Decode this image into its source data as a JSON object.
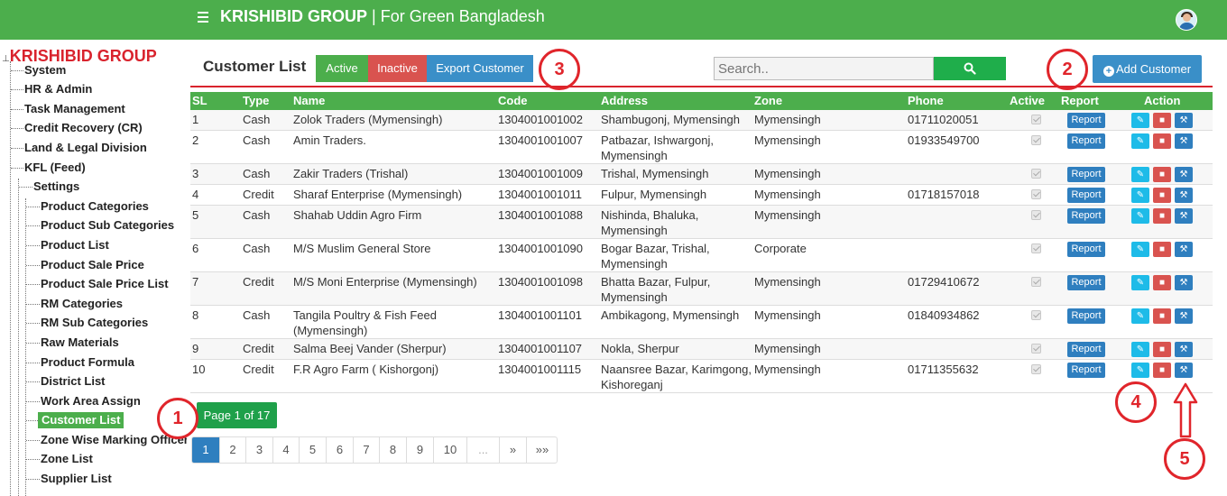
{
  "header": {
    "brand": "KRISHIBID GROUP",
    "separator": " | ",
    "tagline": "For Green Bangladesh"
  },
  "sidebar": {
    "root": "KRISHIBID GROUP",
    "items": [
      {
        "label": "System"
      },
      {
        "label": "HR & Admin"
      },
      {
        "label": "Task Management"
      },
      {
        "label": "Credit Recovery (CR)"
      },
      {
        "label": "Land & Legal Division"
      },
      {
        "label": "KFL (Feed)"
      },
      {
        "label": "Settings"
      },
      {
        "label": "Product Categories"
      },
      {
        "label": "Product Sub Categories"
      },
      {
        "label": "Product List"
      },
      {
        "label": "Product Sale Price"
      },
      {
        "label": "Product Sale Price List"
      },
      {
        "label": "RM Categories"
      },
      {
        "label": "RM Sub Categories"
      },
      {
        "label": "Raw Materials"
      },
      {
        "label": "Product Formula"
      },
      {
        "label": "District List"
      },
      {
        "label": "Work Area Assign"
      },
      {
        "label": "Customer List",
        "active": true
      },
      {
        "label": "Zone Wise Marking Officer"
      },
      {
        "label": "Zone List"
      },
      {
        "label": "Supplier List"
      }
    ]
  },
  "main": {
    "title": "Customer List",
    "buttons": {
      "active": "Active",
      "inactive": "Inactive",
      "export": "Export Customer"
    },
    "search": {
      "placeholder": "Search.."
    },
    "add_button": "Add Customer"
  },
  "table": {
    "columns": [
      "SL",
      "Type",
      "Name",
      "Code",
      "Address",
      "Zone",
      "Phone",
      "Active",
      "Report",
      "Action"
    ],
    "report_label": "Report",
    "rows": [
      {
        "sl": "1",
        "type": "Cash",
        "name": "Zolok Traders (Mymensingh)",
        "code": "1304001001002",
        "address": "Shambugonj, Mymensingh",
        "zone": "Mymensingh",
        "phone": "01711020051"
      },
      {
        "sl": "2",
        "type": "Cash",
        "name": "Amin Traders.",
        "code": "1304001001007",
        "address": "Patbazar, Ishwargonj,\nMymensingh",
        "zone": "Mymensingh",
        "phone": "01933549700"
      },
      {
        "sl": "3",
        "type": "Cash",
        "name": "Zakir Traders (Trishal)",
        "code": "1304001001009",
        "address": "Trishal, Mymensingh",
        "zone": "Mymensingh",
        "phone": ""
      },
      {
        "sl": "4",
        "type": "Credit",
        "name": "Sharaf Enterprise (Mymensingh)",
        "code": "1304001001011",
        "address": "Fulpur, Mymensingh",
        "zone": "Mymensingh",
        "phone": "01718157018"
      },
      {
        "sl": "5",
        "type": "Cash",
        "name": "Shahab Uddin Agro Firm",
        "code": "1304001001088",
        "address": "Nishinda, Bhaluka,\nMymensingh",
        "zone": "Mymensingh",
        "phone": ""
      },
      {
        "sl": "6",
        "type": "Cash",
        "name": "M/S Muslim General Store",
        "code": "1304001001090",
        "address": "Bogar Bazar, Trishal,\nMymensingh",
        "zone": "Corporate",
        "phone": ""
      },
      {
        "sl": "7",
        "type": "Credit",
        "name": "M/S Moni Enterprise (Mymensingh)",
        "code": "1304001001098",
        "address": "Bhatta Bazar, Fulpur,\nMymensingh",
        "zone": "Mymensingh",
        "phone": "01729410672"
      },
      {
        "sl": "8",
        "type": "Cash",
        "name": "Tangila Poultry & Fish Feed\n(Mymensingh)",
        "code": "1304001001101",
        "address": "Ambikagong, Mymensingh",
        "zone": "Mymensingh",
        "phone": "01840934862"
      },
      {
        "sl": "9",
        "type": "Credit",
        "name": "Salma Beej Vander (Sherpur)",
        "code": "1304001001107",
        "address": "Nokla, Sherpur",
        "zone": "Mymensingh",
        "phone": ""
      },
      {
        "sl": "10",
        "type": "Credit",
        "name": "F.R Agro Farm ( Kishorgonj)",
        "code": "1304001001115",
        "address": "Naansree Bazar, Karimgong,\nKishoreganj",
        "zone": "Mymensingh",
        "phone": "01711355632"
      }
    ]
  },
  "pagination": {
    "info": "Page 1 of 17",
    "pages": [
      "1",
      "2",
      "3",
      "4",
      "5",
      "6",
      "7",
      "8",
      "9",
      "10",
      "...",
      "»",
      "»»"
    ],
    "current": "1"
  },
  "annotations": [
    "1",
    "2",
    "3",
    "4",
    "5"
  ],
  "icons": {
    "menu": "hamburger-icon",
    "search": "search-icon",
    "add": "plus-circle-icon",
    "edit": "edit-icon",
    "delete": "trash-icon",
    "settings": "wrench-icon"
  },
  "colors": {
    "header_green": "#4cae4c",
    "brand_red": "#d9232d",
    "primary_blue": "#2f7fbf",
    "danger_red": "#d9534f",
    "info_cyan": "#1ebbe8"
  }
}
